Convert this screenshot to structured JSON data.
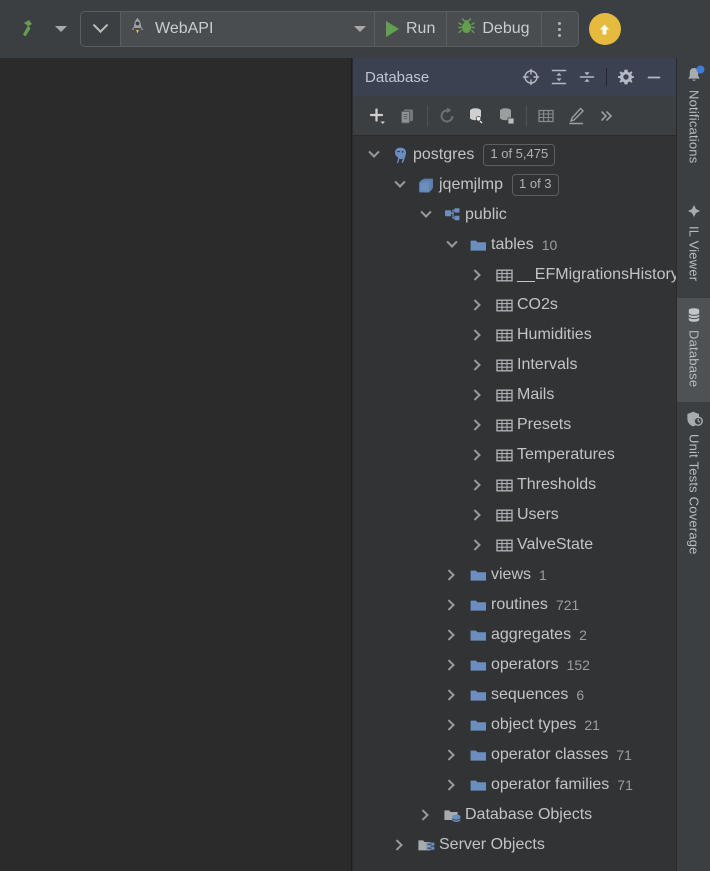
{
  "toolbar": {
    "build_icon": "hammer-icon",
    "build_dropdown_icon": "chevron-down-icon",
    "recent_configs_icon": "chevron-down-icon",
    "run_config": {
      "icon": "rocket-icon",
      "name": "WebAPI",
      "dropdown_icon": "chevron-down-icon"
    },
    "run_label": "Run",
    "run_icon": "play-triangle-icon",
    "debug_label": "Debug",
    "debug_icon": "bug-icon",
    "more_icon": "vertical-dots-icon",
    "update_icon": "arrow-up-circle-icon",
    "accent_green": "#62a050",
    "accent_yellow": "#e5bb3e"
  },
  "database_panel": {
    "title": "Database",
    "header_icons": [
      "crosshair-target-icon",
      "expand-all-icon",
      "collapse-all-icon",
      "settings-gear-icon",
      "minimize-icon"
    ],
    "toolbar_icons": [
      "add-plus-icon",
      "copy-icon",
      "refresh-icon",
      "database-wrench-icon",
      "database-stop-icon",
      "table-grid-icon",
      "edit-pencil-icon",
      "chevrons-right-icon"
    ],
    "header_bg": "#3c4152"
  },
  "tree": [
    {
      "label": "postgres",
      "indent": 0,
      "state": "expanded",
      "icon": "postgres-elephant-icon",
      "badge": "1 of 5,475"
    },
    {
      "label": "jqemjlmp",
      "indent": 1,
      "state": "expanded",
      "icon": "database-stack-icon",
      "badge": "1 of 3"
    },
    {
      "label": "public",
      "indent": 2,
      "state": "expanded",
      "icon": "schema-icon"
    },
    {
      "label": "tables",
      "indent": 3,
      "state": "expanded",
      "icon": "folder-icon",
      "count": "10"
    },
    {
      "label": "__EFMigrationsHistory",
      "indent": 4,
      "state": "collapsed",
      "icon": "table-icon"
    },
    {
      "label": "CO2s",
      "indent": 4,
      "state": "collapsed",
      "icon": "table-icon"
    },
    {
      "label": "Humidities",
      "indent": 4,
      "state": "collapsed",
      "icon": "table-icon"
    },
    {
      "label": "Intervals",
      "indent": 4,
      "state": "collapsed",
      "icon": "table-icon"
    },
    {
      "label": "Mails",
      "indent": 4,
      "state": "collapsed",
      "icon": "table-icon"
    },
    {
      "label": "Presets",
      "indent": 4,
      "state": "collapsed",
      "icon": "table-icon"
    },
    {
      "label": "Temperatures",
      "indent": 4,
      "state": "collapsed",
      "icon": "table-icon"
    },
    {
      "label": "Thresholds",
      "indent": 4,
      "state": "collapsed",
      "icon": "table-icon"
    },
    {
      "label": "Users",
      "indent": 4,
      "state": "collapsed",
      "icon": "table-icon"
    },
    {
      "label": "ValveState",
      "indent": 4,
      "state": "collapsed",
      "icon": "table-icon"
    },
    {
      "label": "views",
      "indent": 3,
      "state": "collapsed",
      "icon": "folder-icon",
      "count": "1"
    },
    {
      "label": "routines",
      "indent": 3,
      "state": "collapsed",
      "icon": "folder-icon",
      "count": "721"
    },
    {
      "label": "aggregates",
      "indent": 3,
      "state": "collapsed",
      "icon": "folder-icon",
      "count": "2"
    },
    {
      "label": "operators",
      "indent": 3,
      "state": "collapsed",
      "icon": "folder-icon",
      "count": "152"
    },
    {
      "label": "sequences",
      "indent": 3,
      "state": "collapsed",
      "icon": "folder-icon",
      "count": "6"
    },
    {
      "label": "object types",
      "indent": 3,
      "state": "collapsed",
      "icon": "folder-icon",
      "count": "21"
    },
    {
      "label": "operator classes",
      "indent": 3,
      "state": "collapsed",
      "icon": "folder-icon",
      "count": "71"
    },
    {
      "label": "operator families",
      "indent": 3,
      "state": "collapsed",
      "icon": "folder-icon",
      "count": "71"
    },
    {
      "label": "Database Objects",
      "indent": 2,
      "state": "collapsed",
      "icon": "database-objects-icon"
    },
    {
      "label": "Server Objects",
      "indent": 1,
      "state": "collapsed",
      "icon": "server-objects-icon"
    }
  ],
  "right_stripe": [
    {
      "label": "Notifications",
      "icon": "bell-icon",
      "active": false,
      "has_dot": true
    },
    {
      "label": "IL Viewer",
      "icon": "diamond-icon",
      "active": false,
      "has_dot": false
    },
    {
      "label": "Database",
      "icon": "database-icon",
      "active": true,
      "has_dot": false
    },
    {
      "label": "Unit Tests Coverage",
      "icon": "shield-icon",
      "active": false,
      "has_dot": false
    }
  ]
}
